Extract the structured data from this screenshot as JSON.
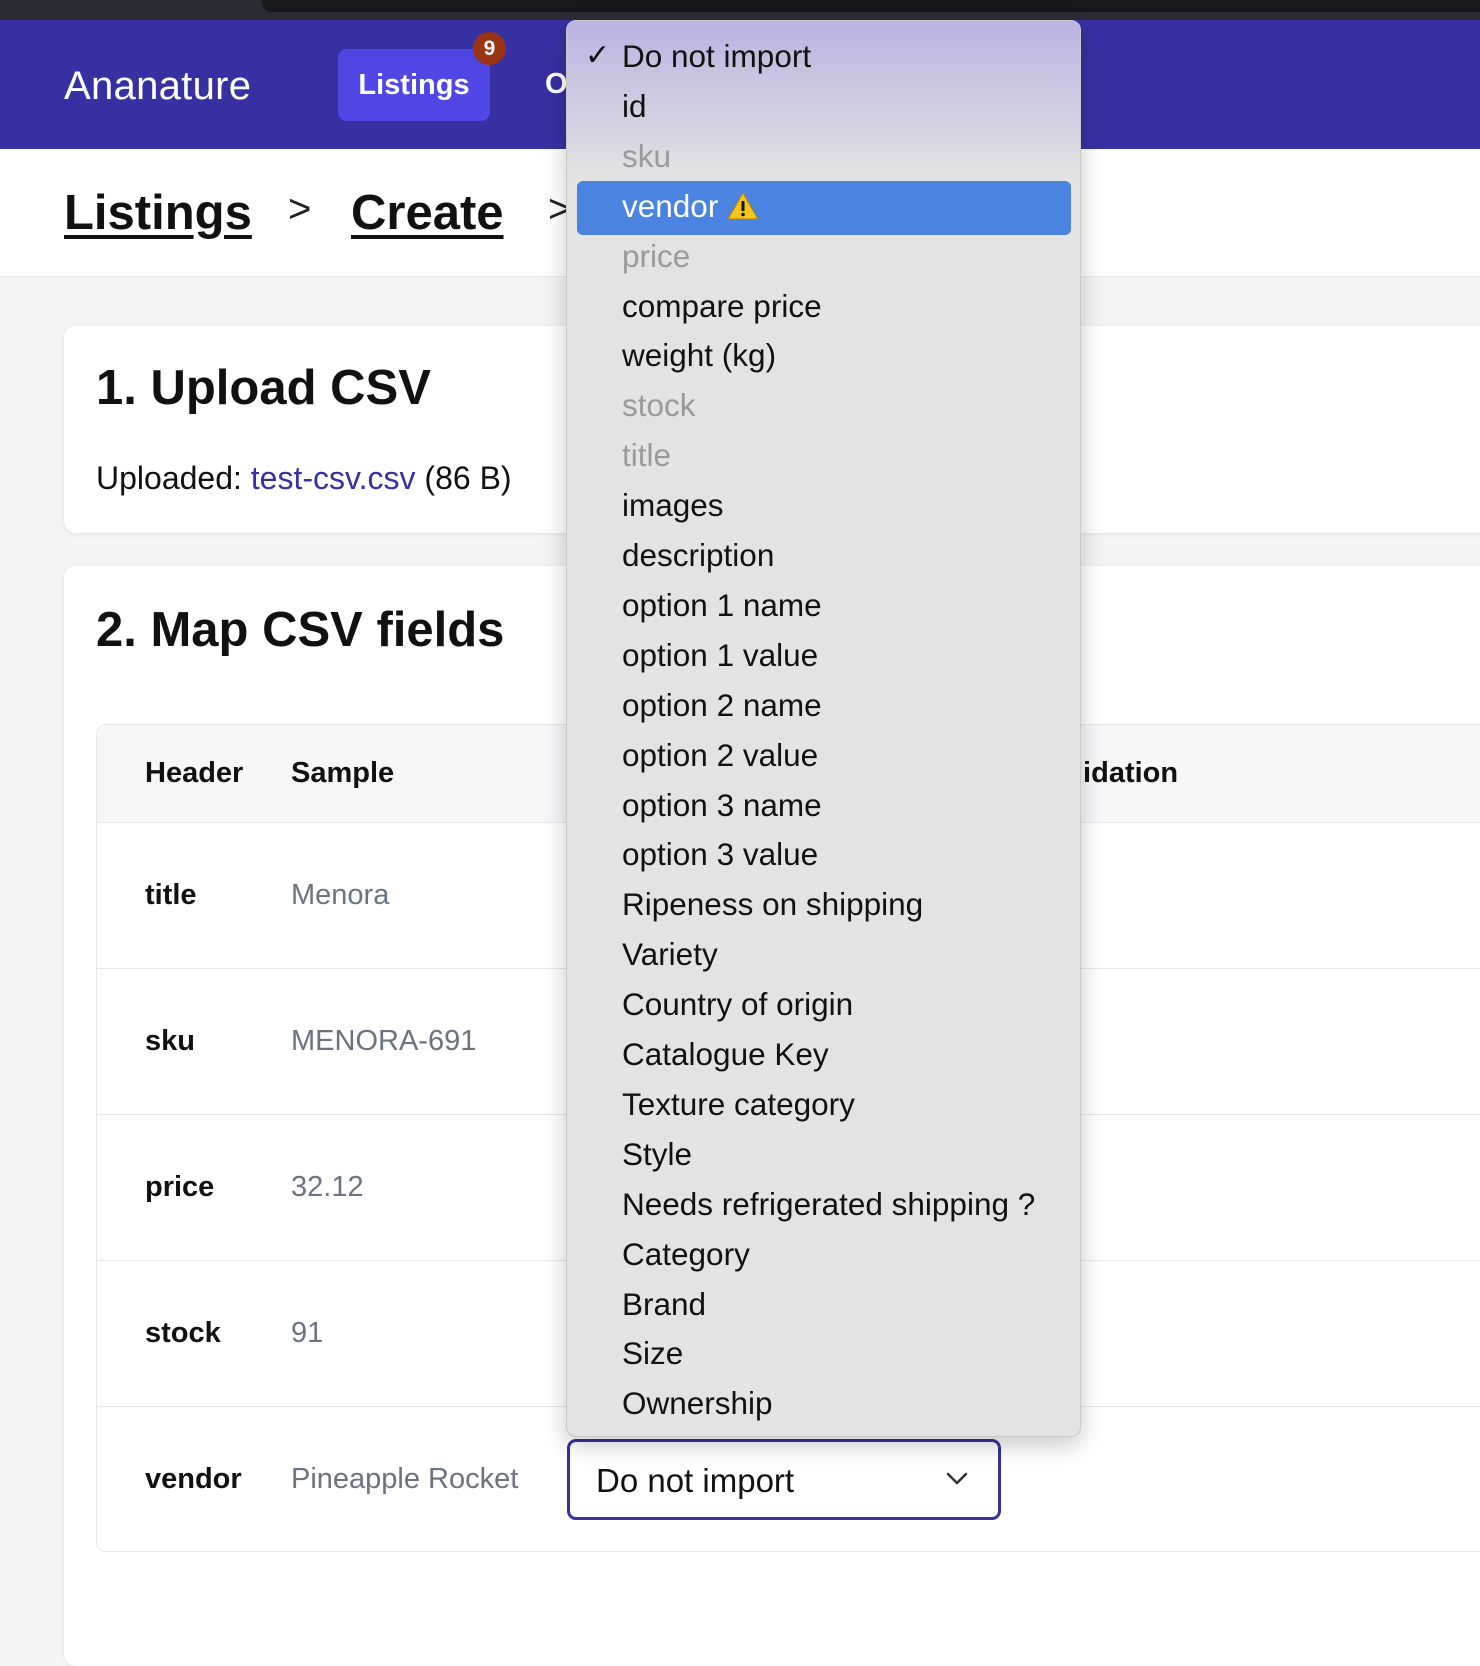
{
  "nav": {
    "brand": "Ananature",
    "tabs": [
      {
        "label": "Listings",
        "badge": "9"
      },
      {
        "label": "O"
      }
    ]
  },
  "breadcrumb": {
    "items": [
      "Listings",
      "Create"
    ],
    "separator": ">"
  },
  "upload": {
    "title": "1. Upload CSV",
    "label": "Uploaded: ",
    "filename": "test-csv.csv",
    "size": " (86 B)"
  },
  "mapping": {
    "title": "2. Map CSV fields",
    "columns": [
      "Header",
      "Sample",
      "lidation"
    ],
    "rows": [
      {
        "header": "title",
        "sample": "Menora"
      },
      {
        "header": "sku",
        "sample": "MENORA-691"
      },
      {
        "header": "price",
        "sample": "32.12"
      },
      {
        "header": "stock",
        "sample": "91"
      },
      {
        "header": "vendor",
        "sample": "Pineapple Rocket"
      }
    ],
    "select_value": "Do not import"
  },
  "dropdown": {
    "check": "✓",
    "options": [
      {
        "label": "Do not import",
        "state": "selected"
      },
      {
        "label": "id",
        "state": "normal"
      },
      {
        "label": "sku",
        "state": "disabled"
      },
      {
        "label": "vendor",
        "state": "highlighted",
        "icon": "warning-icon"
      },
      {
        "label": "price",
        "state": "disabled"
      },
      {
        "label": "compare price",
        "state": "normal"
      },
      {
        "label": "weight (kg)",
        "state": "normal"
      },
      {
        "label": "stock",
        "state": "disabled"
      },
      {
        "label": "title",
        "state": "disabled"
      },
      {
        "label": "images",
        "state": "normal"
      },
      {
        "label": "description",
        "state": "normal"
      },
      {
        "label": "option 1 name",
        "state": "normal"
      },
      {
        "label": "option 1 value",
        "state": "normal"
      },
      {
        "label": "option 2 name",
        "state": "normal"
      },
      {
        "label": "option 2 value",
        "state": "normal"
      },
      {
        "label": "option 3 name",
        "state": "normal"
      },
      {
        "label": "option 3 value",
        "state": "normal"
      },
      {
        "label": "Ripeness on shipping",
        "state": "normal"
      },
      {
        "label": "Variety",
        "state": "normal"
      },
      {
        "label": "Country of origin",
        "state": "normal"
      },
      {
        "label": "Catalogue Key",
        "state": "normal"
      },
      {
        "label": "Texture category",
        "state": "normal"
      },
      {
        "label": "Style",
        "state": "normal"
      },
      {
        "label": "Needs refrigerated shipping ?",
        "state": "normal"
      },
      {
        "label": "Category",
        "state": "normal"
      },
      {
        "label": "Brand",
        "state": "normal"
      },
      {
        "label": "Size",
        "state": "normal"
      },
      {
        "label": "Ownership",
        "state": "normal"
      }
    ]
  },
  "colors": {
    "nav_bg": "#3730a3",
    "active_tab": "#4f46e5",
    "badge": "#9a3412",
    "highlight": "#4a84e0",
    "link": "#3730a3",
    "warning": "#f5c518"
  }
}
